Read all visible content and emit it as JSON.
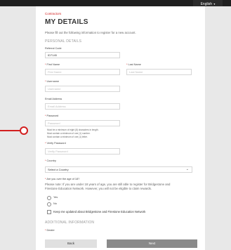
{
  "header": {
    "language_label": "English"
  },
  "form": {
    "breadcrumb": "Contractors",
    "title": "MY DETAILS",
    "intro": "Please fill out the following information to register for a new account.",
    "section_personal": "PERSONAL DETAILS",
    "referral_code": {
      "label": "Referral Code",
      "value": "ID7145"
    },
    "first_name": {
      "label": "First Name",
      "placeholder": "First Name"
    },
    "last_name": {
      "label": "Last Name",
      "placeholder": "Last Name"
    },
    "username": {
      "label": "Username",
      "placeholder": "Username"
    },
    "email": {
      "label": "Email Address",
      "placeholder": "Email Address"
    },
    "password": {
      "label": "Password",
      "placeholder": "Password",
      "hints": [
        "Must be a minimum of eight (8) characters in length.",
        "Must contain a minimum of one (1) number.",
        "Must contain a minimum of one (1) letter."
      ]
    },
    "verify_password": {
      "label": "Verify Password",
      "placeholder": "Verify Password"
    },
    "country": {
      "label": "Country",
      "value": "Select a Country"
    },
    "age_question": {
      "label": "Are you over the age of 18?",
      "note_line1": "Please note: If you are under 18 years of age, you are still able to register for Bridgestone and",
      "note_line2": "Firestone Education Network. However, you will not be eligible to claim rewards.",
      "options": [
        "Yes",
        "No"
      ]
    },
    "updates_checkbox": "Keep me updated about Bridgestone and Firestone Education Network",
    "section_additional": "ADDITIONAL INFORMATION",
    "dealer": {
      "label": "Dealer"
    }
  },
  "footer": {
    "back_label": "Back",
    "next_label": "Next"
  },
  "colors": {
    "accent": "#d21f1f",
    "next_button": "#8a8a8a",
    "top_bar": "#1f1f1f"
  }
}
